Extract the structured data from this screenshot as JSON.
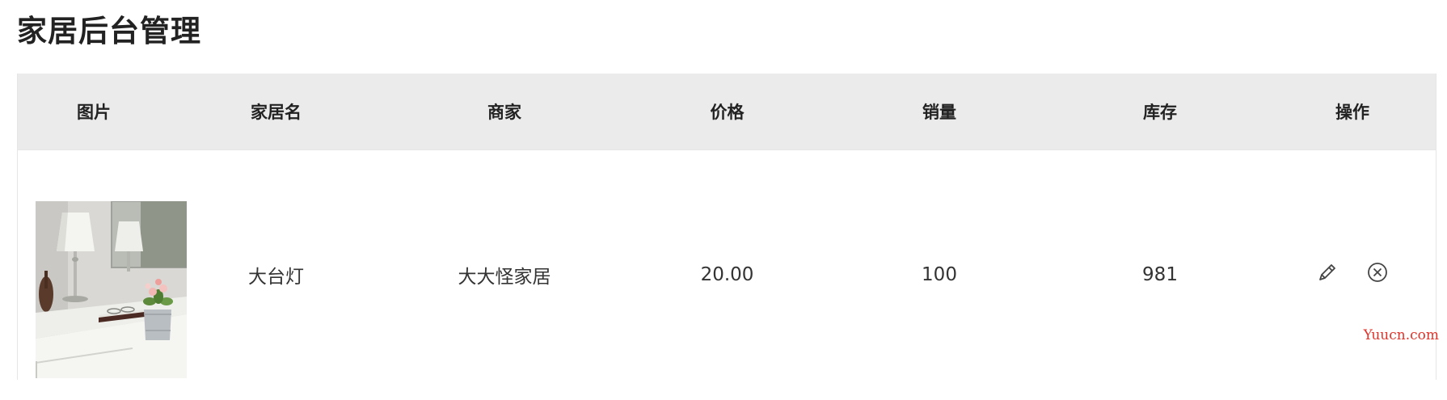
{
  "header": {
    "title": "家居后台管理"
  },
  "table": {
    "columns": [
      "图片",
      "家居名",
      "商家",
      "价格",
      "销量",
      "库存",
      "操作"
    ],
    "rows": [
      {
        "image_alt": "台灯家居图片",
        "name": "大台灯",
        "maker": "大大怪家居",
        "price": "20.00",
        "sales": "100",
        "stock": "981",
        "actions": [
          "pencil-icon",
          "close-circle-icon"
        ]
      }
    ]
  },
  "watermark": "Yuucn.com",
  "colors": {
    "header_bg": "#ebebeb",
    "watermark": "#e0332a",
    "text": "#333333"
  }
}
